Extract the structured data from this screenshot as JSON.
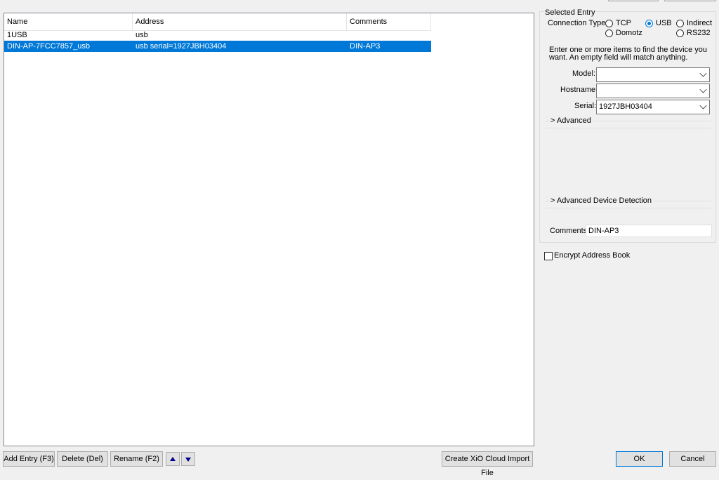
{
  "list": {
    "columns": [
      "Name",
      "Address",
      "Comments"
    ],
    "rows": [
      {
        "name": "1USB",
        "address": "usb",
        "comments": ""
      },
      {
        "name": "DIN-AP-7FCC7857_usb",
        "address": "usb serial=1927JBH03404",
        "comments": "DIN-AP3",
        "selected": true
      }
    ]
  },
  "bottom_buttons": {
    "add": "Add Entry (F3)",
    "delete": "Delete (Del)",
    "rename": "Rename (F2)",
    "move_up_icon": "arrow-up-icon",
    "move_down_icon": "arrow-down-icon",
    "create_cloud": "Create XiO Cloud Import File",
    "ok": "OK",
    "cancel": "Cancel"
  },
  "selected_entry": {
    "title": "Selected Entry",
    "connection_type_label": "Connection Type:",
    "options": [
      "TCP",
      "USB",
      "Indirect",
      "Domotz",
      "RS232"
    ],
    "selected_option": "USB",
    "help_text_line1": "Enter one or more items to find the device you",
    "help_text_line2": "want.  An empty field will match anything.",
    "model_label": "Model:",
    "model_value": "",
    "hostname_label": "Hostname:",
    "hostname_value": "",
    "serial_label": "Serial:",
    "serial_value": "1927JBH03404",
    "advanced": "Advanced",
    "advanced_detection": "Advanced Device Detection",
    "comments_label": "Comments:",
    "comments_value": "DIN-AP3"
  },
  "encrypt_label": "Encrypt Address Book",
  "encrypt_checked": false,
  "colors": {
    "selection": "#0078d7",
    "window_bg": "#f0f0f0"
  }
}
